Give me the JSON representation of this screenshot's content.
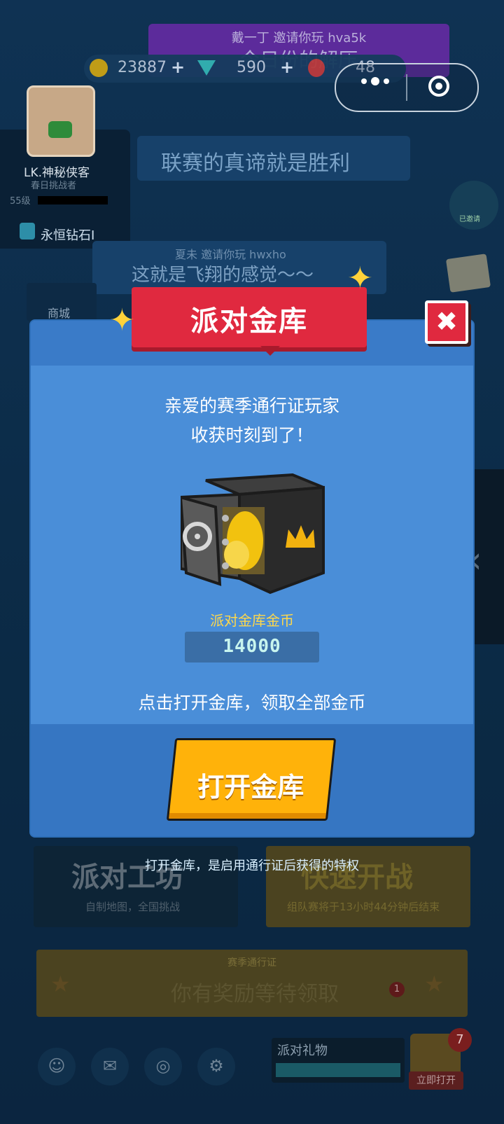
{
  "top_banner": {
    "small": "戴一丁 邀请你玩 hva5k",
    "big": "今日份的解压"
  },
  "currency": {
    "coins": "23887",
    "gems": "590",
    "energy": "48"
  },
  "profile": {
    "name": "LK.神秘侠客",
    "title": "春日挑战者",
    "level": "55级",
    "rank": "永恒钻石I"
  },
  "chat": {
    "line1": "联赛的真谛就是胜利",
    "line2_small": "夏未 邀请你玩 hwxho",
    "line2_big": "这就是飞翔的感觉～～"
  },
  "shop_label": "商城",
  "right_badge": "已邀请",
  "modal": {
    "title": "派对金库",
    "greeting_line1": "亲爱的赛季通行证玩家",
    "greeting_line2": "收获时刻到了！",
    "coin_label": "派对金库金币",
    "coin_amount": "14000",
    "hint": "点击打开金库，领取全部金币",
    "open_button": "打开金库",
    "close_symbol": "✖"
  },
  "footnote": "打开金库，是启用通行证后获得的特权",
  "workshop": {
    "title": "派对工坊",
    "sub": "自制地图，全国挑战"
  },
  "quick_battle": {
    "title": "快速开战",
    "sub": "组队赛将于13小时44分钟后结束"
  },
  "season_pass": {
    "label": "赛季通行证",
    "text": "你有奖励等待领取",
    "badge": "1"
  },
  "party_gift": {
    "label": "派对礼物",
    "open": "立即打开",
    "badge": "7"
  },
  "colors": {
    "modal_blue": "#4a8ed8",
    "ribbon_red": "#e0293f",
    "button_yellow": "#ffb20a",
    "coin_text": "#ffd84a"
  }
}
